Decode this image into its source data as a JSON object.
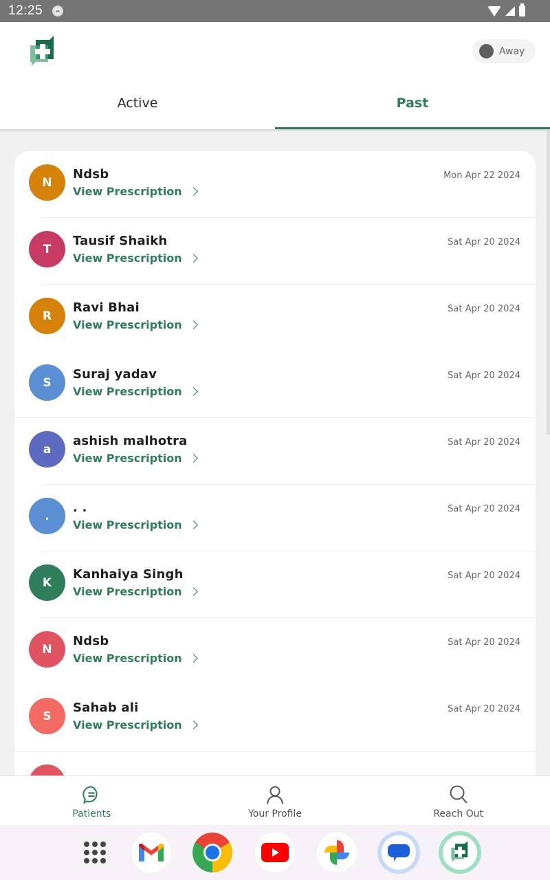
{
  "status_bar": {
    "time": "12:25",
    "icons": [
      "notification-icon",
      "wifi-icon",
      "signal-icon",
      "battery-icon"
    ]
  },
  "header": {
    "logo": "app-logo-medical-chat",
    "availability": {
      "label": "Away",
      "dot_color": "#5f5f5f"
    }
  },
  "tabs": [
    {
      "label": "Active",
      "selected": false
    },
    {
      "label": "Past",
      "selected": true
    }
  ],
  "theme": {
    "accent": "#2e7d5b",
    "background": "#f1f1f1"
  },
  "patients": [
    {
      "initial": "N",
      "name": "Ndsb",
      "link": "View Prescription",
      "date": "Mon Apr 22 2024",
      "avatar_color": "#d4820a",
      "divider": "inset"
    },
    {
      "initial": "T",
      "name": "Tausif Shaikh",
      "link": "View Prescription",
      "date": "Sat Apr 20 2024",
      "avatar_color": "#c73b63",
      "divider": "inset"
    },
    {
      "initial": "R",
      "name": "Ravi Bhai",
      "link": "View Prescription",
      "date": "Sat Apr 20 2024",
      "avatar_color": "#d4820a",
      "divider": "none"
    },
    {
      "initial": "S",
      "name": "Suraj yadav",
      "link": "View Prescription",
      "date": "Sat Apr 20 2024",
      "avatar_color": "#5a8fd4",
      "divider": "full"
    },
    {
      "initial": "a",
      "name": "ashish malhotra",
      "link": "View Prescription",
      "date": "Sat Apr 20 2024",
      "avatar_color": "#5c6bc0",
      "divider": "inset"
    },
    {
      "initial": ".",
      "name": ". .",
      "link": "View Prescription",
      "date": "Sat Apr 20 2024",
      "avatar_color": "#5a8fd4",
      "divider": "inset"
    },
    {
      "initial": "K",
      "name": "Kanhaiya Singh",
      "link": "View Prescription",
      "date": "Sat Apr 20 2024",
      "avatar_color": "#2e7d5b",
      "divider": "inset"
    },
    {
      "initial": "N",
      "name": "Ndsb",
      "link": "View Prescription",
      "date": "Sat Apr 20 2024",
      "avatar_color": "#df5460",
      "divider": "none"
    },
    {
      "initial": "S",
      "name": "Sahab ali",
      "link": "View Prescription",
      "date": "Sat Apr 20 2024",
      "avatar_color": "#f26a62",
      "divider": "full"
    },
    {
      "initial": "",
      "name": "",
      "link": "",
      "date": "",
      "avatar_color": "#df5460",
      "divider": "none"
    }
  ],
  "bottom_nav": [
    {
      "label": "Patients",
      "icon": "chat-icon",
      "active": true
    },
    {
      "label": "Your Profile",
      "icon": "person-icon",
      "active": false
    },
    {
      "label": "Reach Out",
      "icon": "search-icon",
      "active": false
    }
  ],
  "dock": [
    {
      "name": "app-drawer"
    },
    {
      "name": "gmail"
    },
    {
      "name": "chrome"
    },
    {
      "name": "youtube"
    },
    {
      "name": "photos"
    },
    {
      "name": "messages"
    },
    {
      "name": "medical-app"
    }
  ]
}
